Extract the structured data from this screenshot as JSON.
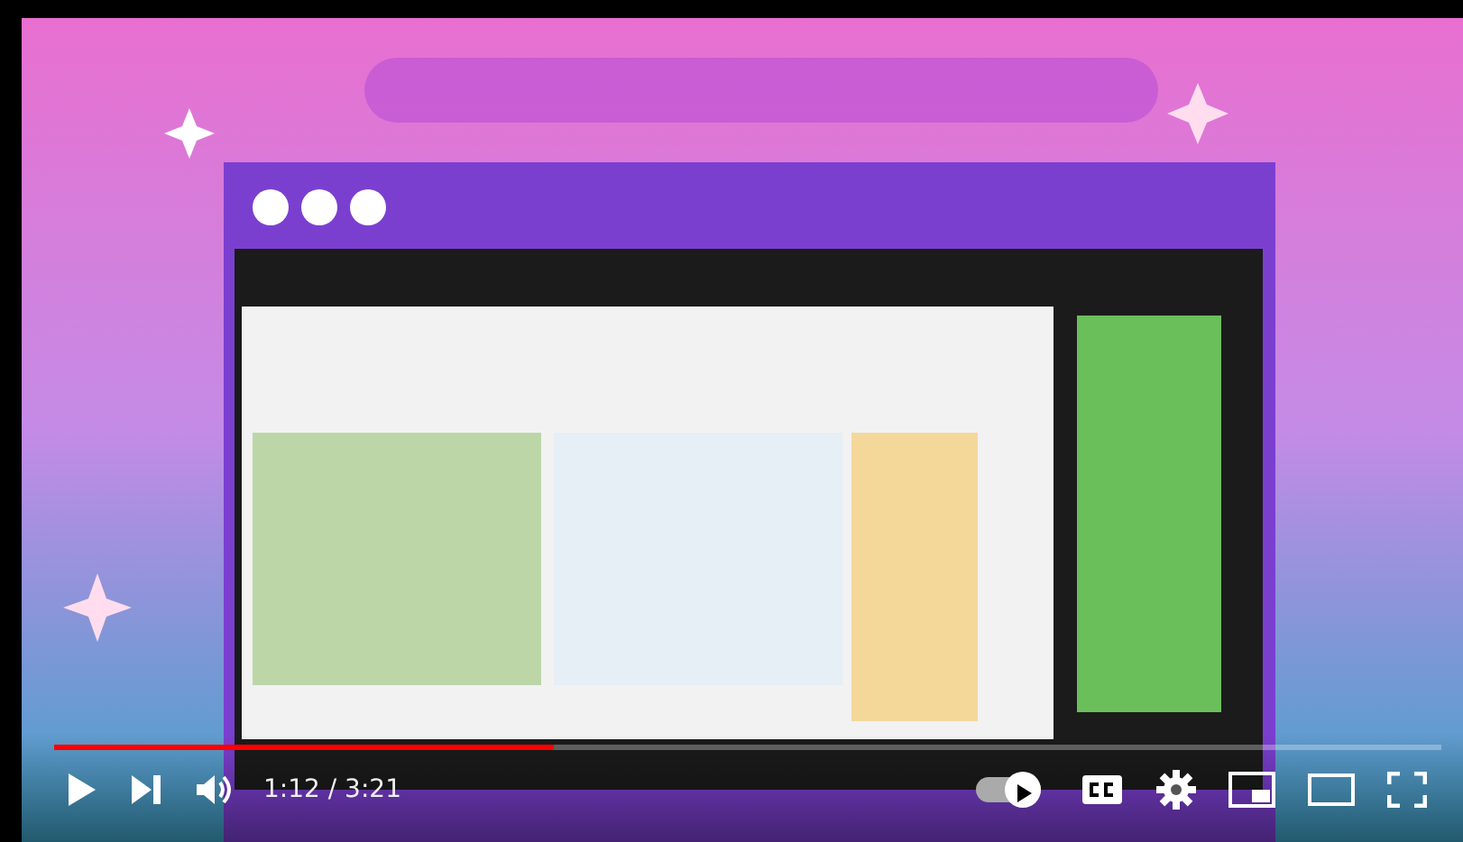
{
  "progress": {
    "level": 0.36
  },
  "time": "1:12 / 3:21",
  "autoplay": {
    "on": true
  },
  "captions": {
    "on": false
  }
}
